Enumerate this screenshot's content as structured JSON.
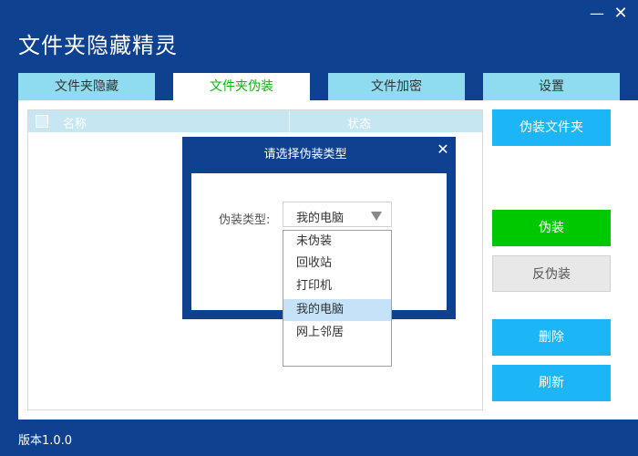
{
  "window": {
    "title": "文件夹隐藏精灵",
    "minimize_glyph": "—",
    "close_glyph": "✕"
  },
  "tabs": [
    {
      "label": "文件夹隐藏",
      "active": false
    },
    {
      "label": "文件夹伪装",
      "active": true
    },
    {
      "label": "文件加密",
      "active": false
    },
    {
      "label": "设置",
      "active": false
    }
  ],
  "file_list": {
    "columns": [
      "名称",
      "状态"
    ],
    "rows": []
  },
  "buttons": {
    "disguise_folder": "伪装文件夹",
    "disguise": "伪装",
    "undisguise": "反伪装",
    "delete": "删除",
    "refresh": "刷新"
  },
  "dialog": {
    "title": "请选择伪装类型",
    "close_glyph": "✕",
    "type_label": "伪装类型:",
    "selected_value": "我的电脑",
    "options": [
      "未伪装",
      "回收站",
      "打印机",
      "我的电脑",
      "网上邻居"
    ]
  },
  "footer": {
    "version": "版本1.0.0"
  },
  "colors": {
    "background": "#0f4191",
    "tab_inactive": "#8fdcf0",
    "tab_active_text": "#0cb40c",
    "button_primary": "#1cb5f5",
    "button_green": "#00c800",
    "button_disabled": "#e8e8e8",
    "option_highlight": "#c5e2f8"
  }
}
